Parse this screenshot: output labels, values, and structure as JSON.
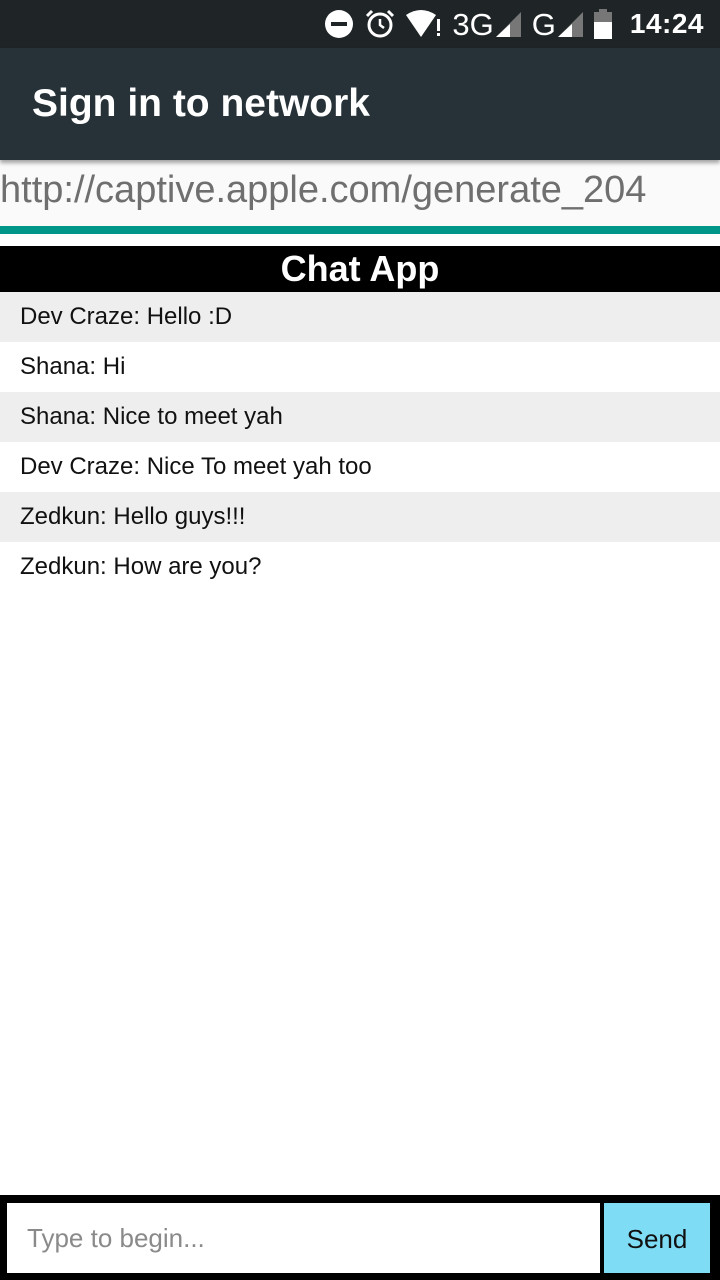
{
  "status_bar": {
    "time": "14:24",
    "network_label_1": "3G",
    "network_label_2": "G",
    "icons": [
      "dnd-icon",
      "alarm-icon",
      "wifi-warning-icon",
      "signal-3g-icon",
      "signal-g-icon",
      "battery-icon"
    ]
  },
  "app_bar": {
    "title": "Sign in to network"
  },
  "url_bar": {
    "url": "http://captive.apple.com/generate_204"
  },
  "page_progress": {
    "percent": 100,
    "color": "#009688"
  },
  "chat": {
    "title": "Chat App",
    "messages": [
      {
        "text": "Dev Craze: Hello :D"
      },
      {
        "text": "Shana: Hi"
      },
      {
        "text": "Shana: Nice to meet yah"
      },
      {
        "text": "Dev Craze: Nice To meet yah too"
      },
      {
        "text": "Zedkun: Hello guys!!!"
      },
      {
        "text": "Zedkun: How are you?"
      }
    ]
  },
  "composer": {
    "input_value": "",
    "placeholder": "Type to begin...",
    "send_label": "Send"
  },
  "colors": {
    "status_bar": "#1f2427",
    "app_bar": "#263238",
    "accent": "#009688",
    "send_button": "#7fdcf5"
  }
}
